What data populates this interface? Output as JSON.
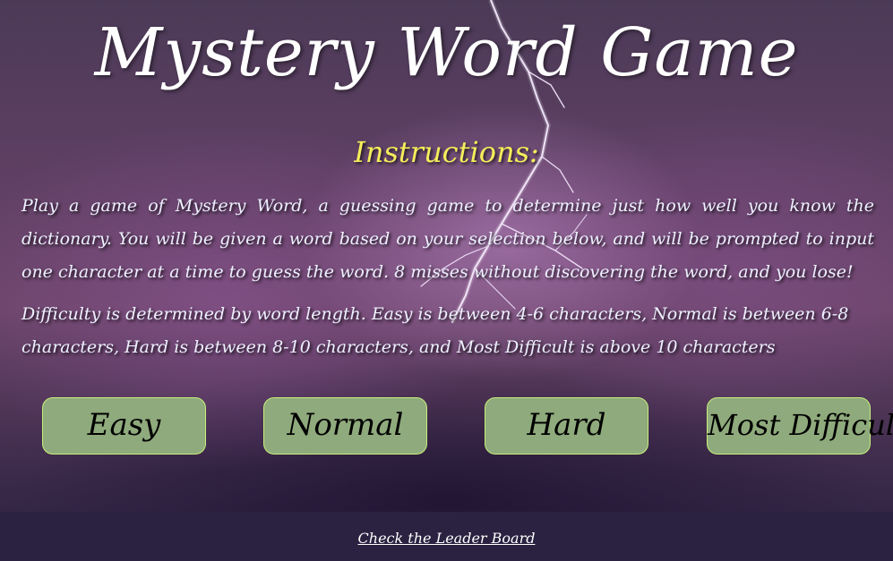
{
  "page": {
    "title": "Mystery Word Game",
    "instructions_heading": "Instructions:",
    "paragraph_1": "Play a game of Mystery Word, a guessing game to determine just how well you know the dictionary. You will be given a word based on your selection below, and will be prompted to input one character at a time to guess the word. 8 misses without discovering the word, and you lose!",
    "paragraph_2": "Difficulty is determined by word length. Easy is between 4-6 characters, Normal is between 6-8 characters, Hard is between 8-10 characters, and Most Difficult is above 10 characters"
  },
  "difficulty": {
    "easy_label": "Easy",
    "normal_label": "Normal",
    "hard_label": "Hard",
    "most_difficult_label": "Most Difficult"
  },
  "footer": {
    "leader_board_link": "Check the Leader Board"
  },
  "colors": {
    "heading_accent": "#f5ee5a",
    "button_fill": "#8faa7c",
    "button_border": "#c6f07a",
    "footer_bg": "#2a2240"
  }
}
